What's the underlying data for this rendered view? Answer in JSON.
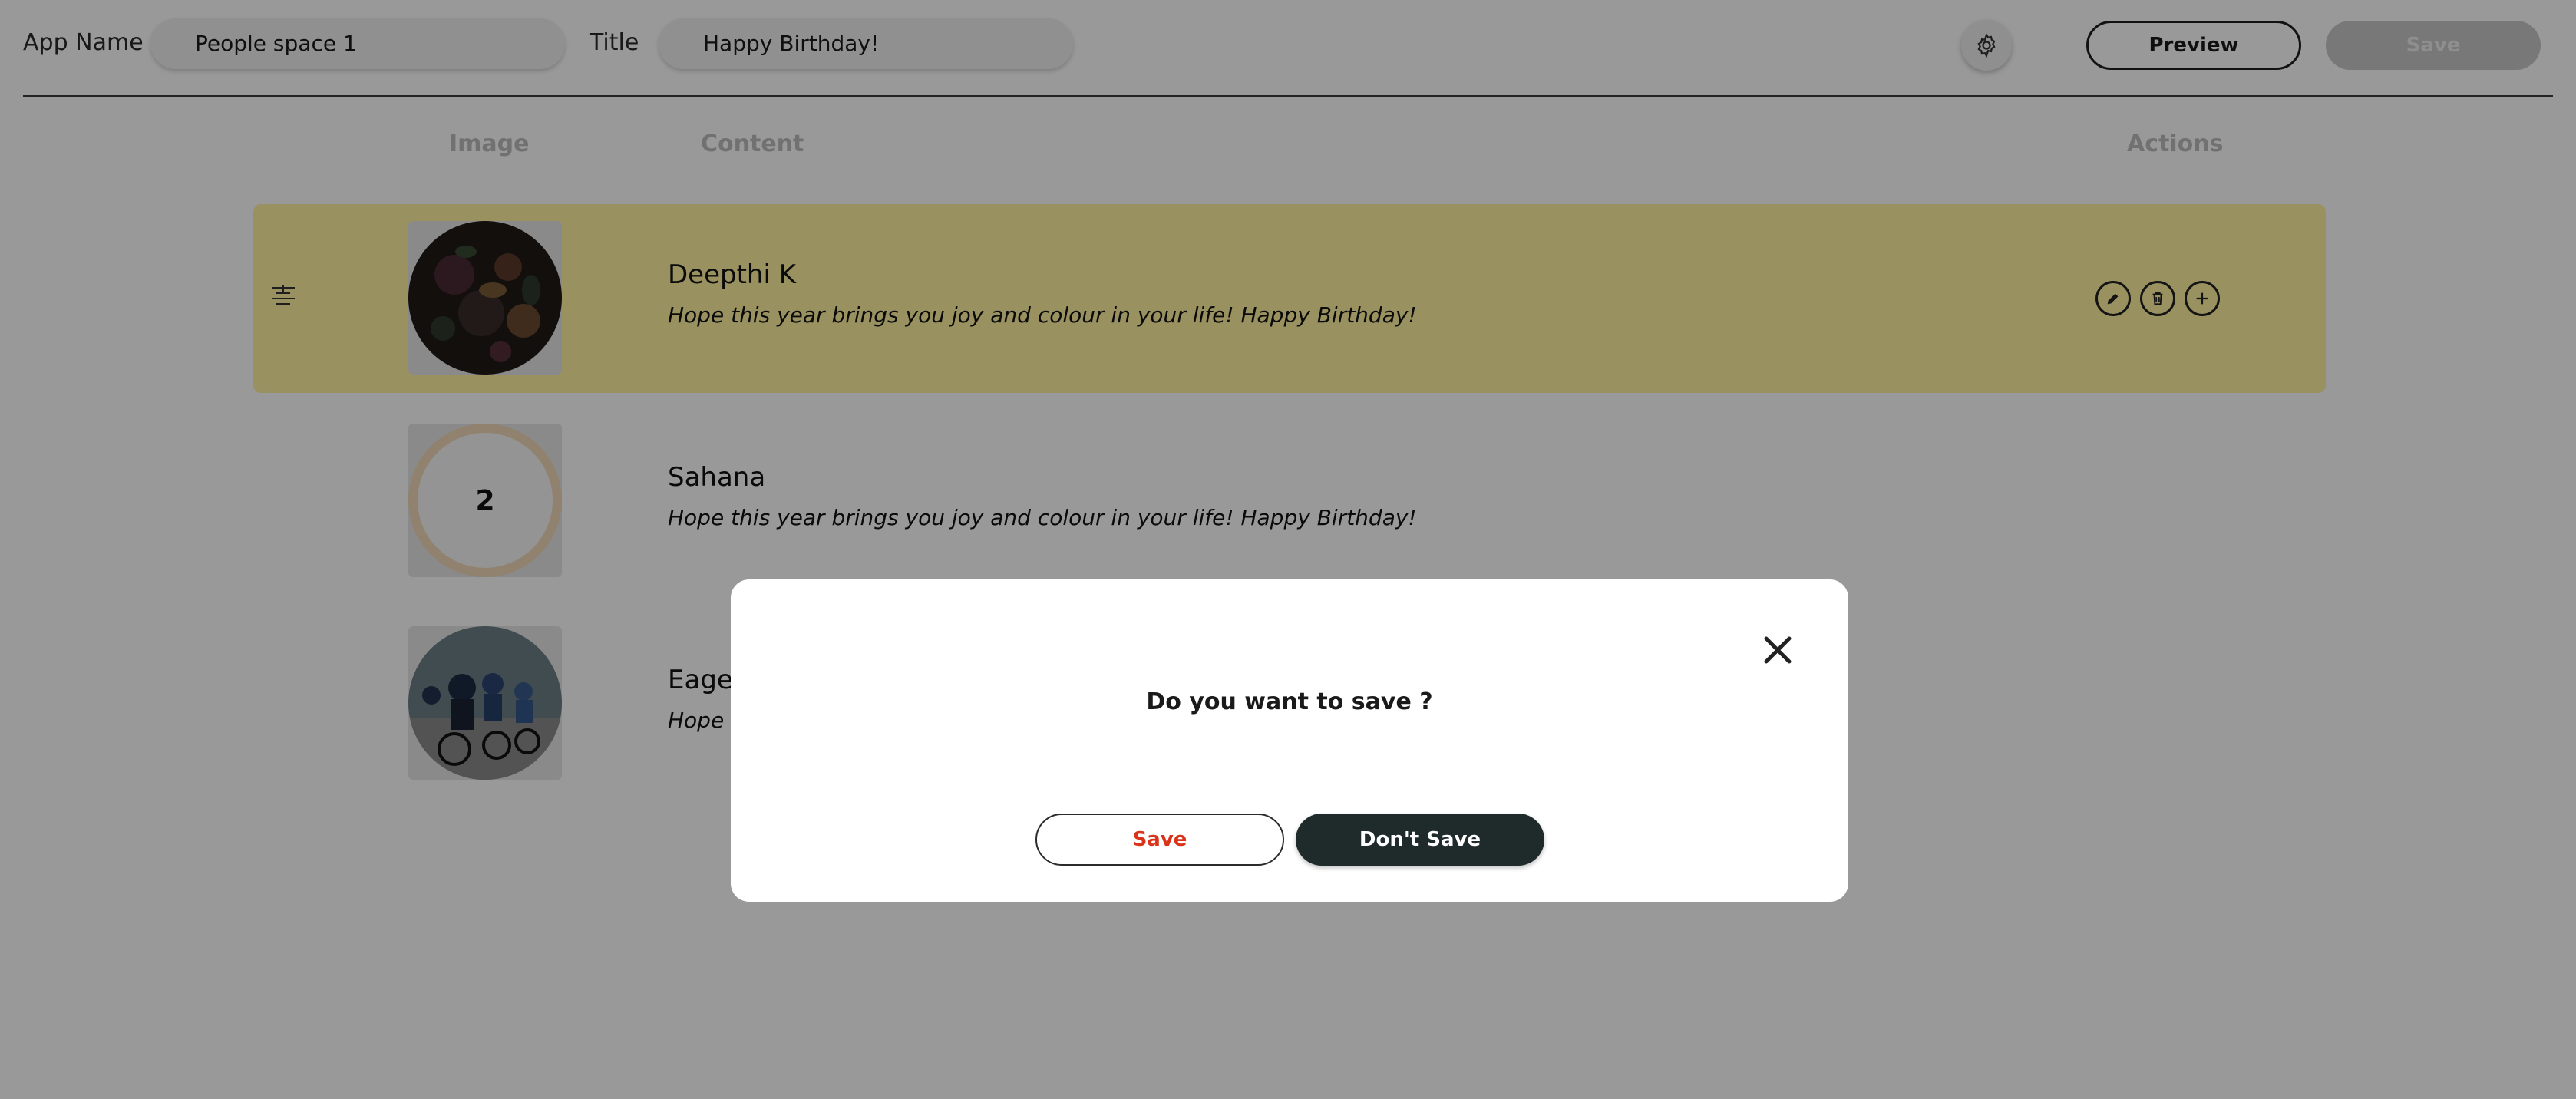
{
  "header": {
    "app_name_label": "App Name",
    "app_name_value": "People space 1",
    "title_label": "Title",
    "title_value": "Happy Birthday!",
    "settings_icon": "gear-icon",
    "preview_label": "Preview",
    "save_label": "Save"
  },
  "table": {
    "columns": [
      "Image",
      "Content",
      "Actions"
    ],
    "rows": [
      {
        "name": "Deepthi K",
        "message": "Hope this year brings you joy and colour in your life! Happy Birthday!",
        "image": "flowers-photo",
        "highlighted": true
      },
      {
        "name": "Sahana",
        "message": "Hope this year brings you joy and colour in your life! Happy Birthday!",
        "image_number": "2",
        "highlighted": false
      },
      {
        "name": "Eagew",
        "message": "Hope t",
        "image": "cyclists-photo",
        "highlighted": false
      }
    ],
    "action_icons": [
      "edit-icon",
      "trash-icon",
      "plus-icon"
    ]
  },
  "modal": {
    "question": "Do you want to save ?",
    "save_label": "Save",
    "dont_save_label": "Don't Save",
    "close_icon": "close-icon"
  },
  "colors": {
    "row_highlight": "#fff29e",
    "modal_save_text": "#d9331a",
    "dont_save_bg": "#1f2b2b",
    "overlay": "rgba(0,0,0,0.4)"
  }
}
